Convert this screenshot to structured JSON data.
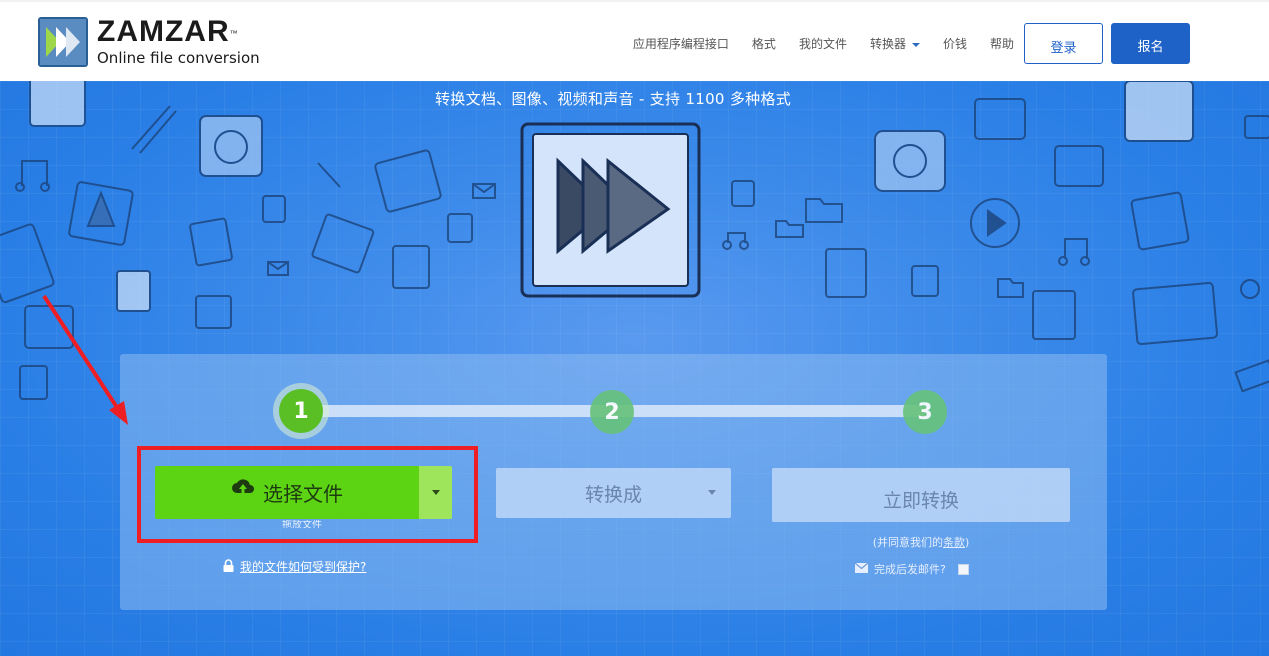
{
  "header": {
    "logo_name": "ZAMZAR",
    "logo_tm": "™",
    "logo_sub": "Online file conversion",
    "nav": [
      {
        "label": "应用程序编程接口"
      },
      {
        "label": "格式"
      },
      {
        "label": "我的文件"
      },
      {
        "label": "转换器",
        "has_dropdown": true
      },
      {
        "label": "价钱"
      },
      {
        "label": "帮助"
      }
    ],
    "login_label": "登录",
    "signup_label": "报名"
  },
  "hero": {
    "tagline": "转换文档、图像、视频和声音 - 支持 1100 多种格式"
  },
  "converter": {
    "steps": [
      "1",
      "2",
      "3"
    ],
    "choose_files_label": "选择文件",
    "choose_hint": "拖放文件",
    "protect_link": "我的文件如何受到保护?",
    "convert_to_label": "转换成",
    "convert_now_label": "立即转换",
    "terms_prefix": "(并同意我们的",
    "terms_link": "条款",
    "terms_suffix": ")",
    "email_label": "完成后发邮件?"
  },
  "colors": {
    "brand_blue": "#1f62c7",
    "hero_blue": "#2f86e6",
    "step_active": "#59bf24",
    "choose_green": "#5cd413",
    "annotation_red": "#ee1f24"
  },
  "icons": {
    "logo": "zamzar-fast-forward-logo",
    "upload": "cloud-upload-icon",
    "lock": "lock-icon",
    "envelope": "envelope-icon",
    "caret": "caret-down-icon"
  }
}
